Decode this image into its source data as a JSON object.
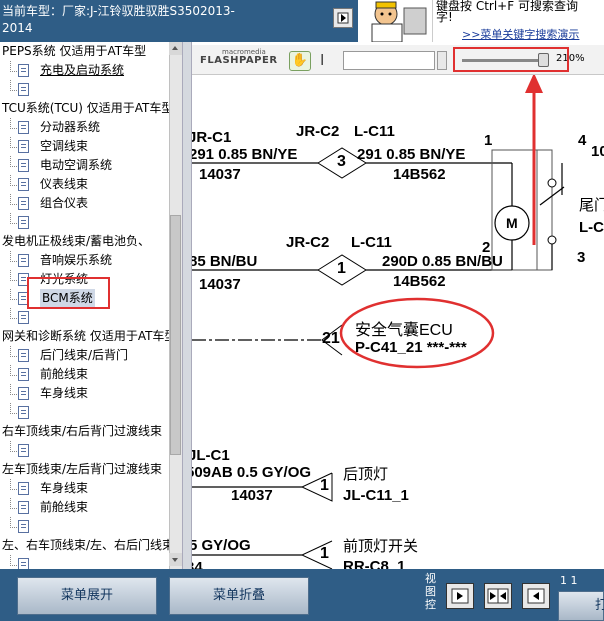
{
  "header": {
    "title": "当前车型：厂家:J-江铃驭胜驭胜S3502013-2014",
    "ad_line_1": "键盘按 Ctrl+F 可搜索查询",
    "ad_line_2": "字!",
    "ad_link": ">>菜单关键字搜索演示"
  },
  "tree": {
    "rows": [
      {
        "type": "group",
        "label": "PEPS系统 仅适用于AT车型"
      },
      {
        "type": "leaf",
        "label": "充电及启动系统",
        "underline": true
      },
      {
        "type": "leaf",
        "label": ""
      },
      {
        "type": "group",
        "label": "TCU系统(TCU) 仅适用于AT车型"
      },
      {
        "type": "leaf",
        "label": "分动器系统"
      },
      {
        "type": "leaf",
        "label": "空调线束"
      },
      {
        "type": "leaf",
        "label": "电动空调系统"
      },
      {
        "type": "leaf",
        "label": "仪表线束"
      },
      {
        "type": "leaf",
        "label": "组合仪表"
      },
      {
        "type": "leaf",
        "label": ""
      },
      {
        "type": "group",
        "label": "发电机正极线束/蓄电池负、"
      },
      {
        "type": "leaf",
        "label": "音响娱乐系统"
      },
      {
        "type": "leaf",
        "label": "灯光系统"
      },
      {
        "type": "leaf",
        "label": "BCM系统",
        "selected": true
      },
      {
        "type": "leaf",
        "label": ""
      },
      {
        "type": "group",
        "label": "网关和诊断系统 仅适用于AT车型"
      },
      {
        "type": "leaf",
        "label": "后门线束/后背门"
      },
      {
        "type": "leaf",
        "label": "前舱线束"
      },
      {
        "type": "leaf",
        "label": "车身线束"
      },
      {
        "type": "leaf",
        "label": ""
      },
      {
        "type": "group",
        "label": "右车顶线束/右后背门过渡线束"
      },
      {
        "type": "leaf",
        "label": ""
      },
      {
        "type": "group",
        "label": "左车顶线束/左后背门过渡线束"
      },
      {
        "type": "leaf",
        "label": "车身线束"
      },
      {
        "type": "leaf",
        "label": "前舱线束"
      },
      {
        "type": "leaf",
        "label": ""
      },
      {
        "type": "group",
        "label": "左、右车顶线束/左、右后门线束"
      },
      {
        "type": "leaf",
        "label": ""
      }
    ]
  },
  "flashpaper": {
    "logo_top": "macromedia",
    "logo": "FLASHPAPER",
    "hand_tool": "✋",
    "text_tool": "I",
    "search_value": "",
    "zoom_percent": 210,
    "zoom_label": "210%"
  },
  "document": {
    "labels": [
      {
        "id": "t1",
        "text": "JR-C1"
      },
      {
        "id": "t2",
        "text": "JR-C2"
      },
      {
        "id": "t3",
        "text": "L-C11"
      },
      {
        "id": "t4",
        "text": "291 0.85 BN/YE"
      },
      {
        "id": "t5",
        "text": "291 0.85 BN/YE"
      },
      {
        "id": "t6",
        "text": "14037"
      },
      {
        "id": "t7",
        "text": "14B562"
      },
      {
        "id": "t8",
        "text": "1"
      },
      {
        "id": "t9",
        "text": "4"
      },
      {
        "id": "t10",
        "text": "10"
      },
      {
        "id": "t11",
        "text": "JR-C2"
      },
      {
        "id": "t12",
        "text": "L-C11"
      },
      {
        "id": "t13",
        "text": "85 BN/BU"
      },
      {
        "id": "t14",
        "text": "290D 0.85 BN/BU"
      },
      {
        "id": "t15",
        "text": "14037"
      },
      {
        "id": "t16",
        "text": "14B562"
      },
      {
        "id": "t17",
        "text": "2"
      },
      {
        "id": "t18",
        "text": "3"
      },
      {
        "id": "t19",
        "text": "尾门"
      },
      {
        "id": "t20",
        "text": "L-C"
      },
      {
        "id": "t21",
        "text": "安全气囊ECU"
      },
      {
        "id": "t22",
        "text": "P-C41_21 ***-***"
      },
      {
        "id": "t23",
        "text": "JL-C1"
      },
      {
        "id": "t24",
        "text": "509AB 0.5 GY/OG"
      },
      {
        "id": "t25",
        "text": "14037"
      },
      {
        "id": "t26",
        "text": "后顶灯"
      },
      {
        "id": "t27",
        "text": "JL-C11_1"
      },
      {
        "id": "t28",
        "text": "5 GY/OG"
      },
      {
        "id": "t29",
        "text": "34"
      },
      {
        "id": "t30",
        "text": "前顶灯开关"
      },
      {
        "id": "t31",
        "text": "RR-C8_1"
      }
    ],
    "connectors": [
      "3",
      "1",
      "21",
      "1",
      "1"
    ],
    "motor_label": "M"
  },
  "bottom": {
    "expand_label": "菜单展开",
    "collapse_label": "菜单折叠",
    "view_label": "视图控",
    "page_indicator": "1 1",
    "right_button_label": "打"
  },
  "colors": {
    "header_bg": "#2f5d86",
    "highlight_red": "#e03030",
    "link_blue": "#1a3c9a"
  }
}
